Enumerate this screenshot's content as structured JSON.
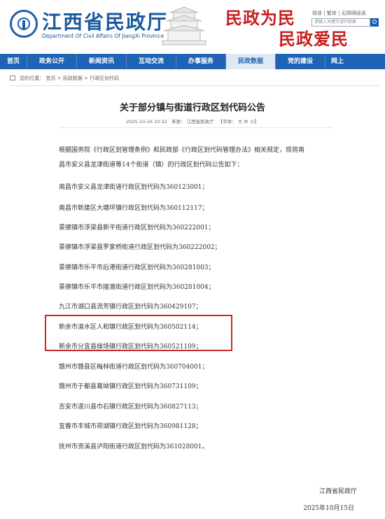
{
  "header": {
    "title": "江西省民政厅",
    "subtitle": "Department Of Civil Affairs Of JiangXi Province",
    "slogan_line1": "民政为民",
    "slogan_line2": "民政爱民",
    "top_links": "简体 | 繁体 | 无障碍阅读",
    "search_placeholder": "请输入关键字进行检索"
  },
  "nav": {
    "items": [
      "首页",
      "政务公开",
      "新闻资讯",
      "互动交流",
      "办事服务",
      "民政数据",
      "党的建设",
      "网上"
    ],
    "active_index": 5
  },
  "breadcrumb": {
    "prefix": "您的位置：",
    "items": [
      "首页",
      "民政数据",
      "行政区划代码"
    ],
    "separator": ">"
  },
  "article": {
    "title": "关于部分镇与街道行政区划代码公告",
    "date": "2025-10-16 10:32",
    "source": "来源： 江西省民政厅",
    "font_size": "【字体： 大 中 小】",
    "intro_line1": "根据国务院《行政区划管理条例》和民政部《行政区划代码管理办法》相关规定，现将南",
    "intro_line2": "昌市安义县龙津街道等14个街道（镇）的行政区划代码公告如下：",
    "items": [
      "南昌市安义县龙津街道行政区划代码为360123001；",
      "南昌市新建区大塘坪镇行政区划代码为360112117；",
      "景德镇市浮梁县新平街道行政区划代码为360222001；",
      "景德镇市浮梁县罗家桥街道行政区划代码为360222002；",
      "景德镇市乐平市后港街道行政区划代码为360281003；",
      "景德镇市乐平市接渡街道行政区划代码为360281004；",
      "九江市湖口县流芳镇行政区划代码为360429107；",
      "新余市渝水区人和镇行政区划代码为360502114；",
      "新余市分宜县操场镇行政区划代码为360521109；",
      "赣州市赣县区梅林街道行政区划代码为360704001；",
      "赣州市于都县葛坳镇行政区划代码为360731109；",
      "吉安市遂川县巾石镇行政区划代码为360827113；",
      "宜春市丰城市荷湖镇行政区划代码为360981128；",
      "抚州市资溪县泸阳街道行政区划代码为361028001。"
    ],
    "signature": "江西省民政厅",
    "sign_date": "2025年10月15日"
  },
  "colors": {
    "brand_blue": "#1f63b5",
    "slogan_red": "#c81e1e",
    "highlight_red": "#c62a2a"
  }
}
